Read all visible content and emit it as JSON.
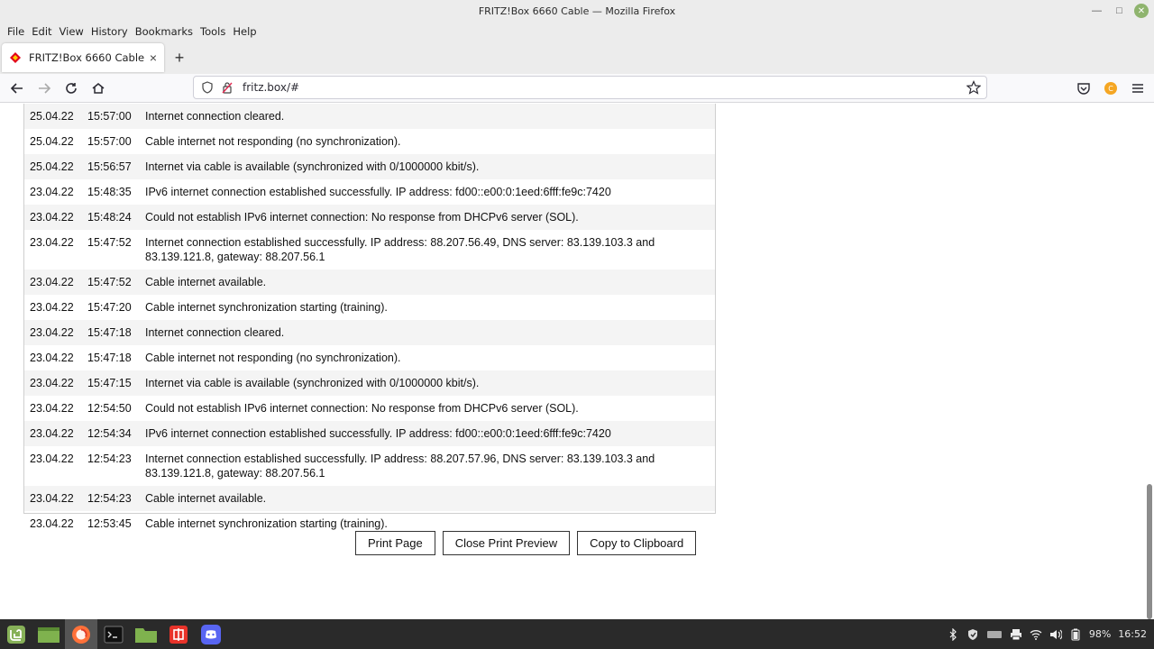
{
  "window": {
    "title": "FRITZ!Box 6660 Cable — Mozilla Firefox"
  },
  "menu": [
    "File",
    "Edit",
    "View",
    "History",
    "Bookmarks",
    "Tools",
    "Help"
  ],
  "tab": {
    "label": "FRITZ!Box 6660 Cable",
    "close": "×",
    "new": "+"
  },
  "url": "fritz.box/#",
  "log": [
    {
      "date": "25.04.22",
      "time": "15:57:00",
      "msg": "Internet connection cleared."
    },
    {
      "date": "25.04.22",
      "time": "15:57:00",
      "msg": "Cable internet not responding (no synchronization)."
    },
    {
      "date": "25.04.22",
      "time": "15:56:57",
      "msg": "Internet via cable is available (synchronized with 0/1000000 kbit/s)."
    },
    {
      "date": "23.04.22",
      "time": "15:48:35",
      "msg": "IPv6 internet connection established successfully. IP address: fd00::e00:0:1eed:6fff:fe9c:7420"
    },
    {
      "date": "23.04.22",
      "time": "15:48:24",
      "msg": "Could not establish IPv6 internet connection: No response from DHCPv6 server (SOL)."
    },
    {
      "date": "23.04.22",
      "time": "15:47:52",
      "msg": "Internet connection established successfully. IP address: 88.207.56.49, DNS server: 83.139.103.3 and 83.139.121.8, gateway: 88.207.56.1"
    },
    {
      "date": "23.04.22",
      "time": "15:47:52",
      "msg": "Cable internet available."
    },
    {
      "date": "23.04.22",
      "time": "15:47:20",
      "msg": "Cable internet synchronization starting (training)."
    },
    {
      "date": "23.04.22",
      "time": "15:47:18",
      "msg": "Internet connection cleared."
    },
    {
      "date": "23.04.22",
      "time": "15:47:18",
      "msg": "Cable internet not responding (no synchronization)."
    },
    {
      "date": "23.04.22",
      "time": "15:47:15",
      "msg": "Internet via cable is available (synchronized with 0/1000000 kbit/s)."
    },
    {
      "date": "23.04.22",
      "time": "12:54:50",
      "msg": "Could not establish IPv6 internet connection: No response from DHCPv6 server (SOL)."
    },
    {
      "date": "23.04.22",
      "time": "12:54:34",
      "msg": "IPv6 internet connection established successfully. IP address: fd00::e00:0:1eed:6fff:fe9c:7420"
    },
    {
      "date": "23.04.22",
      "time": "12:54:23",
      "msg": "Internet connection established successfully. IP address: 88.207.57.96, DNS server: 83.139.103.3 and 83.139.121.8, gateway: 88.207.56.1"
    },
    {
      "date": "23.04.22",
      "time": "12:54:23",
      "msg": "Cable internet available."
    },
    {
      "date": "23.04.22",
      "time": "12:53:45",
      "msg": "Cable internet synchronization starting (training)."
    }
  ],
  "buttons": {
    "print": "Print Page",
    "close_preview": "Close Print Preview",
    "copy": "Copy to Clipboard"
  },
  "tray": {
    "battery": "98%",
    "clock": "16:52"
  },
  "colors": {
    "alt_row": "#f4f4f4",
    "taskbar": "#2a2a2a",
    "mint_green": "#87b158"
  }
}
